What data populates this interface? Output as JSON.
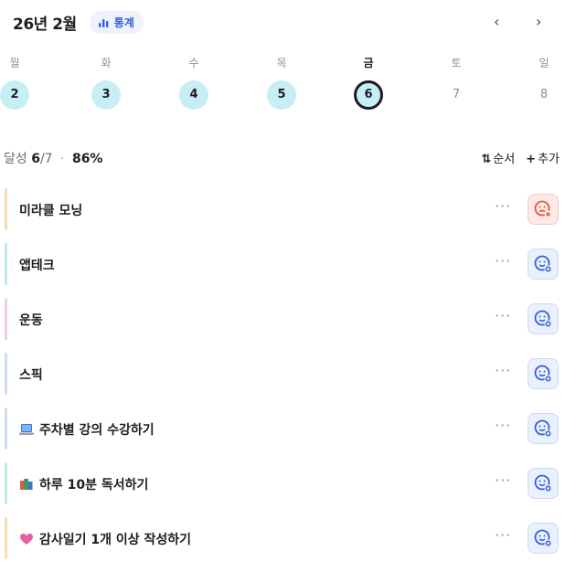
{
  "header": {
    "month": "26년 2월",
    "stats_label": "통계",
    "prev": "‹",
    "next": "›"
  },
  "week": [
    {
      "name": "월",
      "num": "2",
      "state": "done"
    },
    {
      "name": "화",
      "num": "3",
      "state": "done"
    },
    {
      "name": "수",
      "num": "4",
      "state": "done"
    },
    {
      "name": "목",
      "num": "5",
      "state": "done"
    },
    {
      "name": "금",
      "num": "6",
      "state": "today"
    },
    {
      "name": "토",
      "num": "7",
      "state": "future"
    },
    {
      "name": "일",
      "num": "8",
      "state": "future"
    }
  ],
  "summary": {
    "label": "달성",
    "done": "6",
    "total": "/7",
    "dot": "·",
    "percent": "86%"
  },
  "actions": {
    "order_icon": "⇅",
    "order_label": "순서",
    "add_icon": "+",
    "add_label": "추가"
  },
  "items": [
    {
      "title": "미라클 모닝",
      "color": "#f7d9b8",
      "emoji": "",
      "status": "fail"
    },
    {
      "title": "앱테크",
      "color": "#bfe7ef",
      "emoji": "",
      "status": "ok"
    },
    {
      "title": "운동",
      "color": "#f3c9ea",
      "emoji": "",
      "status": "ok"
    },
    {
      "title": "스픽",
      "color": "#cfdcf6",
      "emoji": "",
      "status": "ok"
    },
    {
      "title": "주차별 강의 수강하기",
      "color": "#cfdcf6",
      "emoji": "laptop",
      "status": "ok"
    },
    {
      "title": "하루 10분 독서하기",
      "color": "#bfecdc",
      "emoji": "books",
      "status": "ok"
    },
    {
      "title": "감사일기 1개 이상 작성하기",
      "color": "#f7dcb5",
      "emoji": "heart",
      "status": "ok"
    }
  ],
  "more_label": "···"
}
